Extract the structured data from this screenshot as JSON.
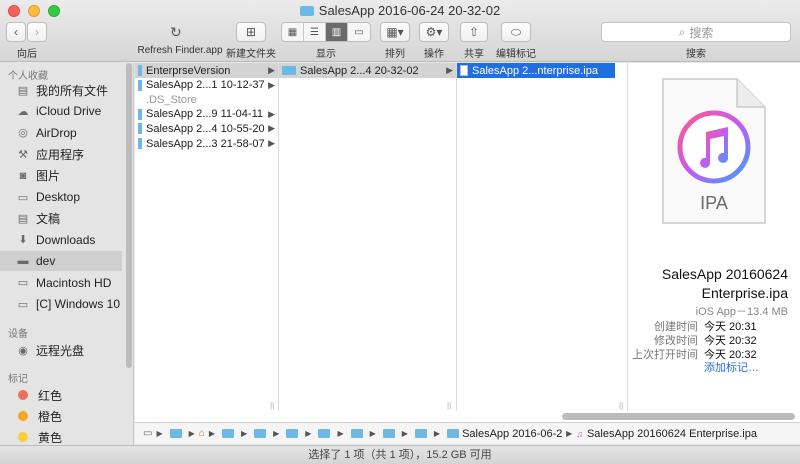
{
  "window": {
    "title": "SalesApp 2016-06-24 20-32-02"
  },
  "toolbar": {
    "back_label": "向后",
    "refresh_label": "Refresh Finder.app",
    "new_folder_label": "新建文件夹",
    "view_label": "显示",
    "arrange_label": "排列",
    "action_label": "操作",
    "share_label": "共享",
    "tags_label": "编辑标记",
    "search_placeholder": "搜索",
    "search_label": "搜索"
  },
  "sidebar": {
    "favorites_header": "个人收藏",
    "favorites": [
      {
        "label": "我的所有文件",
        "icon": "all-files-icon"
      },
      {
        "label": "iCloud Drive",
        "icon": "cloud-icon"
      },
      {
        "label": "AirDrop",
        "icon": "airdrop-icon"
      },
      {
        "label": "应用程序",
        "icon": "applications-icon"
      },
      {
        "label": "图片",
        "icon": "camera-icon"
      },
      {
        "label": "Desktop",
        "icon": "desktop-icon"
      },
      {
        "label": "文稿",
        "icon": "documents-icon"
      },
      {
        "label": "Downloads",
        "icon": "downloads-icon"
      },
      {
        "label": "dev",
        "icon": "folder-icon"
      },
      {
        "label": "Macintosh HD",
        "icon": "disk-icon"
      },
      {
        "label": "[C] Windows 10",
        "icon": "disk-icon"
      }
    ],
    "devices_header": "设备",
    "devices": [
      {
        "label": "远程光盘",
        "icon": "disc-icon"
      }
    ],
    "tags_header": "标记",
    "tags": [
      {
        "label": "红色",
        "color": "#f26d60"
      },
      {
        "label": "橙色",
        "color": "#f5a623"
      },
      {
        "label": "黄色",
        "color": "#f8cf3a"
      }
    ]
  },
  "columns": {
    "col1": [
      {
        "label": "EnterprseVersion",
        "state": "selected"
      },
      {
        "label": "SalesApp 2...1 10-12-37",
        "state": ""
      },
      {
        "label": ".DS_Store",
        "state": "dim"
      },
      {
        "label": "SalesApp 2...9 11-04-11",
        "state": ""
      },
      {
        "label": "SalesApp 2...4 10-55-20",
        "state": ""
      },
      {
        "label": "SalesApp 2...3 21-58-07",
        "state": ""
      }
    ],
    "col2": [
      {
        "label": "SalesApp 2...4 20-32-02",
        "state": "selected"
      }
    ],
    "col3": [
      {
        "label": "SalesApp 2...nterprise.ipa",
        "state": "active"
      }
    ]
  },
  "preview": {
    "icon_label": "IPA",
    "name_line1": "SalesApp 20160624",
    "name_line2": "Enterprise.ipa",
    "kind": "iOS App－13.4 MB",
    "created_label": "创建时间",
    "created_value": "今天 20:31",
    "modified_label": "修改时间",
    "modified_value": "今天 20:32",
    "opened_label": "上次打开时间",
    "opened_value": "今天 20:32",
    "add_tags": "添加标记…"
  },
  "pathbar": {
    "folder_seg": "SalesApp 2016-06-24 20-32-02",
    "file_seg": "SalesApp 20160624 Enterprise.ipa"
  },
  "status": {
    "text": "选择了 1 项（共 1 项），15.2 GB 可用"
  }
}
